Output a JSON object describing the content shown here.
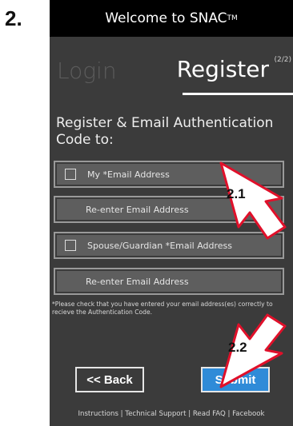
{
  "step_number": "2.",
  "header": {
    "title": "Welcome to SNAC",
    "trademark": "TM"
  },
  "tabs": {
    "login": "Login",
    "register": "Register",
    "register_step": "(2/2)"
  },
  "heading": "Register & Email Authentication Code to:",
  "fields": {
    "my_email": "My *Email Address",
    "my_email_confirm": "Re-enter Email Address",
    "spouse_email": "Spouse/Guardian *Email Address",
    "spouse_email_confirm": "Re-enter Email Address"
  },
  "note": "*Please check that you have entered your email address(es) correctly to recieve the Authentication Code.",
  "buttons": {
    "back": "<< Back",
    "submit": "Submit"
  },
  "footer": "Instructions | Technical Support | Read FAQ | Facebook",
  "callouts": {
    "first": "2.1",
    "second": "2.2"
  },
  "colors": {
    "submit": "#2f8bd8",
    "panel": "#3b3b3b",
    "callout_border": "#e0102a"
  }
}
